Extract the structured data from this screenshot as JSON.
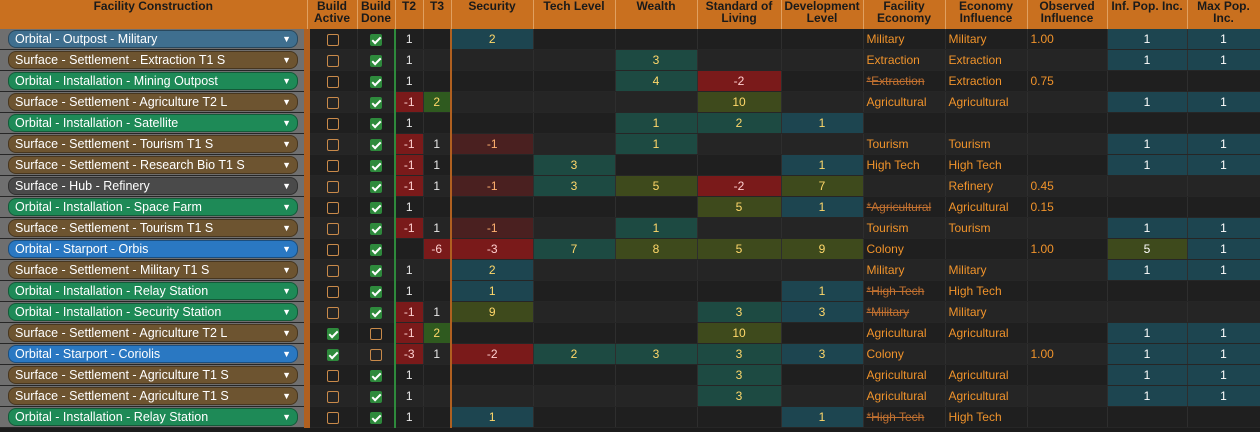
{
  "headers": {
    "facility": "Facility Construction",
    "build_active": "Build Active",
    "build_done": "Build Done",
    "t2": "T2",
    "t3": "T3",
    "security": "Security",
    "tech": "Tech Level",
    "wealth": "Wealth",
    "sol": "Standard of Living",
    "dev": "Development Level",
    "fac_econ": "Facility Economy",
    "econ_infl": "Economy Influence",
    "obs_infl": "Observed Influence",
    "inf_pop": "Inf. Pop. Inc.",
    "max_pop": "Max Pop. Inc."
  },
  "rows": [
    {
      "name": "Orbital - Outpost - Military",
      "style": "orbital-steel",
      "active": false,
      "done": true,
      "t2": "1",
      "t3": "",
      "sec": "2",
      "tech": "",
      "wealth": "",
      "sol": "",
      "dev": "",
      "fe": "Military",
      "fe_strike": false,
      "ei": "Military",
      "oi": "1.00",
      "ip": "1",
      "mp": "1"
    },
    {
      "name": "Surface - Settlement - Extraction T1 S",
      "style": "surface-brown",
      "active": false,
      "done": true,
      "t2": "1",
      "t3": "",
      "sec": "",
      "tech": "",
      "wealth": "3",
      "sol": "",
      "dev": "",
      "fe": "Extraction",
      "fe_strike": false,
      "ei": "Extraction",
      "oi": "",
      "ip": "1",
      "mp": "1"
    },
    {
      "name": "Orbital - Installation - Mining Outpost",
      "style": "orbital-green",
      "active": false,
      "done": true,
      "t2": "1",
      "t3": "",
      "sec": "",
      "tech": "",
      "wealth": "4",
      "sol": "-2",
      "dev": "",
      "fe": "*Extraction",
      "fe_strike": true,
      "ei": "Extraction",
      "oi": "0.75",
      "ip": "",
      "mp": ""
    },
    {
      "name": "Surface - Settlement - Agriculture T2 L",
      "style": "surface-brown",
      "active": false,
      "done": true,
      "t2": "-1",
      "t3": "2",
      "sec": "",
      "tech": "",
      "wealth": "",
      "sol": "10",
      "dev": "",
      "fe": "Agricultural",
      "fe_strike": false,
      "ei": "Agricultural",
      "oi": "",
      "ip": "1",
      "mp": "1"
    },
    {
      "name": "Orbital - Installation - Satellite",
      "style": "orbital-green",
      "active": false,
      "done": true,
      "t2": "1",
      "t3": "",
      "sec": "",
      "tech": "",
      "wealth": "1",
      "sol": "2",
      "dev": "1",
      "fe": "",
      "fe_strike": false,
      "ei": "",
      "oi": "",
      "ip": "",
      "mp": ""
    },
    {
      "name": "Surface - Settlement - Tourism T1 S",
      "style": "surface-brown",
      "active": false,
      "done": true,
      "t2": "-1",
      "t3": "1",
      "sec": "-1",
      "tech": "",
      "wealth": "1",
      "sol": "",
      "dev": "",
      "fe": "Tourism",
      "fe_strike": false,
      "ei": "Tourism",
      "oi": "",
      "ip": "1",
      "mp": "1"
    },
    {
      "name": "Surface - Settlement - Research Bio T1 S",
      "style": "surface-brown",
      "active": false,
      "done": true,
      "t2": "-1",
      "t3": "1",
      "sec": "",
      "tech": "3",
      "wealth": "",
      "sol": "",
      "dev": "1",
      "fe": "High Tech",
      "fe_strike": false,
      "ei": "High Tech",
      "oi": "",
      "ip": "1",
      "mp": "1"
    },
    {
      "name": "Surface - Hub - Refinery",
      "style": "surface-grey",
      "active": false,
      "done": true,
      "t2": "-1",
      "t3": "1",
      "sec": "-1",
      "tech": "3",
      "wealth": "5",
      "sol": "-2",
      "dev": "7",
      "fe": "",
      "fe_strike": false,
      "ei": "Refinery",
      "oi": "0.45",
      "ip": "",
      "mp": ""
    },
    {
      "name": "Orbital - Installation - Space Farm",
      "style": "orbital-green",
      "active": false,
      "done": true,
      "t2": "1",
      "t3": "",
      "sec": "",
      "tech": "",
      "wealth": "",
      "sol": "5",
      "dev": "1",
      "fe": "*Agricultural",
      "fe_strike": true,
      "ei": "Agricultural",
      "oi": "0.15",
      "ip": "",
      "mp": ""
    },
    {
      "name": "Surface - Settlement - Tourism T1 S",
      "style": "surface-brown",
      "active": false,
      "done": true,
      "t2": "-1",
      "t3": "1",
      "sec": "-1",
      "tech": "",
      "wealth": "1",
      "sol": "",
      "dev": "",
      "fe": "Tourism",
      "fe_strike": false,
      "ei": "Tourism",
      "oi": "",
      "ip": "1",
      "mp": "1"
    },
    {
      "name": "Orbital - Starport - Orbis",
      "style": "orbital-blue",
      "active": false,
      "done": true,
      "t2": "",
      "t3": "-6",
      "sec": "-3",
      "tech": "7",
      "wealth": "8",
      "sol": "5",
      "dev": "9",
      "fe": "Colony",
      "fe_strike": false,
      "ei": "",
      "oi": "1.00",
      "ip": "5",
      "mp": "1"
    },
    {
      "name": "Surface - Settlement - Military T1 S",
      "style": "surface-brown",
      "active": false,
      "done": true,
      "t2": "1",
      "t3": "",
      "sec": "2",
      "tech": "",
      "wealth": "",
      "sol": "",
      "dev": "",
      "fe": "Military",
      "fe_strike": false,
      "ei": "Military",
      "oi": "",
      "ip": "1",
      "mp": "1"
    },
    {
      "name": "Orbital - Installation - Relay Station",
      "style": "orbital-green",
      "active": false,
      "done": true,
      "t2": "1",
      "t3": "",
      "sec": "1",
      "tech": "",
      "wealth": "",
      "sol": "",
      "dev": "1",
      "fe": "*High Tech",
      "fe_strike": true,
      "ei": "High Tech",
      "oi": "",
      "ip": "",
      "mp": ""
    },
    {
      "name": "Orbital - Installation - Security Station",
      "style": "orbital-green",
      "active": false,
      "done": true,
      "t2": "-1",
      "t3": "1",
      "sec": "9",
      "tech": "",
      "wealth": "",
      "sol": "3",
      "dev": "3",
      "fe": "*Military",
      "fe_strike": true,
      "ei": "Military",
      "oi": "",
      "ip": "",
      "mp": ""
    },
    {
      "name": "Surface - Settlement - Agriculture T2 L",
      "style": "surface-brown",
      "active": true,
      "done": false,
      "t2": "-1",
      "t3": "2",
      "sec": "",
      "tech": "",
      "wealth": "",
      "sol": "10",
      "dev": "",
      "fe": "Agricultural",
      "fe_strike": false,
      "ei": "Agricultural",
      "oi": "",
      "ip": "1",
      "mp": "1"
    },
    {
      "name": "Orbital - Starport - Coriolis",
      "style": "orbital-blue",
      "active": true,
      "done": false,
      "t2": "-3",
      "t3": "1",
      "sec": "-2",
      "tech": "2",
      "wealth": "3",
      "sol": "3",
      "dev": "3",
      "fe": "Colony",
      "fe_strike": false,
      "ei": "",
      "oi": "1.00",
      "ip": "1",
      "mp": "1"
    },
    {
      "name": "Surface - Settlement - Agriculture T1 S",
      "style": "surface-brown",
      "active": false,
      "done": true,
      "t2": "1",
      "t3": "",
      "sec": "",
      "tech": "",
      "wealth": "",
      "sol": "3",
      "dev": "",
      "fe": "Agricultural",
      "fe_strike": false,
      "ei": "Agricultural",
      "oi": "",
      "ip": "1",
      "mp": "1"
    },
    {
      "name": "Surface - Settlement - Agriculture T1 S",
      "style": "surface-brown",
      "active": false,
      "done": true,
      "t2": "1",
      "t3": "",
      "sec": "",
      "tech": "",
      "wealth": "",
      "sol": "3",
      "dev": "",
      "fe": "Agricultural",
      "fe_strike": false,
      "ei": "Agricultural",
      "oi": "",
      "ip": "1",
      "mp": "1"
    },
    {
      "name": "Orbital - Installation - Relay Station",
      "style": "orbital-green",
      "active": false,
      "done": true,
      "t2": "1",
      "t3": "",
      "sec": "1",
      "tech": "",
      "wealth": "",
      "sol": "",
      "dev": "1",
      "fe": "*High Tech",
      "fe_strike": true,
      "ei": "High Tech",
      "oi": "",
      "ip": "",
      "mp": ""
    }
  ]
}
